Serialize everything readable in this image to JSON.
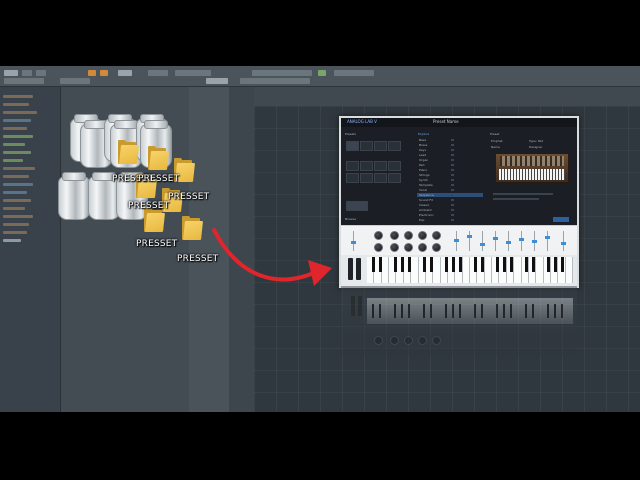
{
  "folder_labels": [
    "PRESSET",
    "PRESSET",
    "PRESSET",
    "PRESSET",
    "PRESSET",
    "PRESSET"
  ],
  "plugin": {
    "title": "ANALOG LAB V",
    "preset_bar": "Preset Name",
    "sections": {
      "left": "Presets",
      "mid": "Explore",
      "right": "Preset"
    },
    "list": [
      "Bass",
      "Brass",
      "Keys",
      "Lead",
      "Organ",
      "Pad",
      "Piano",
      "Strings",
      "Synth",
      "Template",
      "Vocal",
      "Sequence",
      "Sound FX",
      "Classic",
      "Ambient",
      "Electronic",
      "Pop"
    ],
    "right_labels": [
      "Prophet",
      "Type: Pad",
      "Name",
      "Designer"
    ],
    "footer": "Browse"
  },
  "colors": {
    "arrow": "#e0252c",
    "accent": "#3c8fd6",
    "folder": "#f0c34a"
  },
  "icons": [
    "jar-icon",
    "folder-icon",
    "arrow-icon",
    "keyboard-icon"
  ]
}
